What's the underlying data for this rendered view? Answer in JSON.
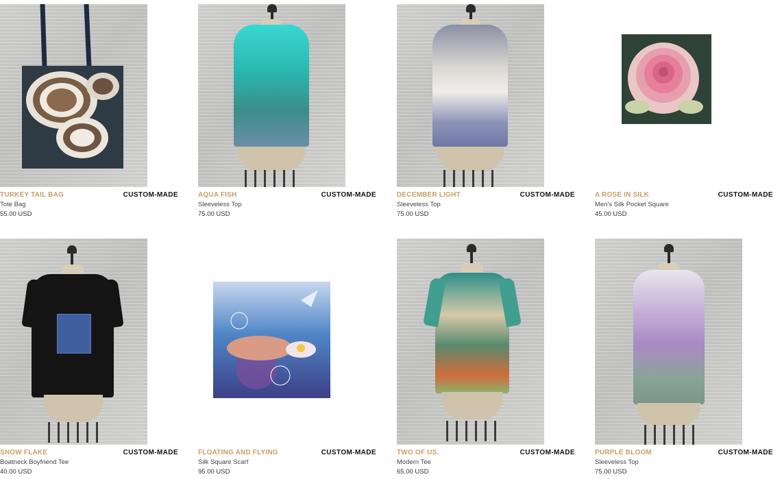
{
  "badge_label": "CUSTOM-MADE",
  "products": [
    {
      "title": "TURKEY TAIL BAG",
      "type": "Tote Bag",
      "price": "55.00 USD"
    },
    {
      "title": "AQUA FISH",
      "type": "Sleeveless Top",
      "price": "75.00 USD"
    },
    {
      "title": "DECEMBER LIGHT",
      "type": "Sleeveless Top",
      "price": "75.00 USD"
    },
    {
      "title": "A ROSE IN SILK",
      "type": "Men's Silk Pocket Square",
      "price": "45.00 USD"
    },
    {
      "title": "SNOW FLAKE",
      "type": "Boatneck Boyfriend Tee",
      "price": "40.00 USD"
    },
    {
      "title": "FLOATING AND FLYING",
      "type": "Silk Square Scarf",
      "price": "95.00 USD"
    },
    {
      "title": "TWO OF US.",
      "type": "Modern Tee",
      "price": "65.00 USD"
    },
    {
      "title": "PURPLE BLOOM",
      "type": "Sleeveless Top",
      "price": "75.00 USD"
    }
  ],
  "colors": {
    "title_accent": "#c8a064",
    "badge": "#111111"
  }
}
